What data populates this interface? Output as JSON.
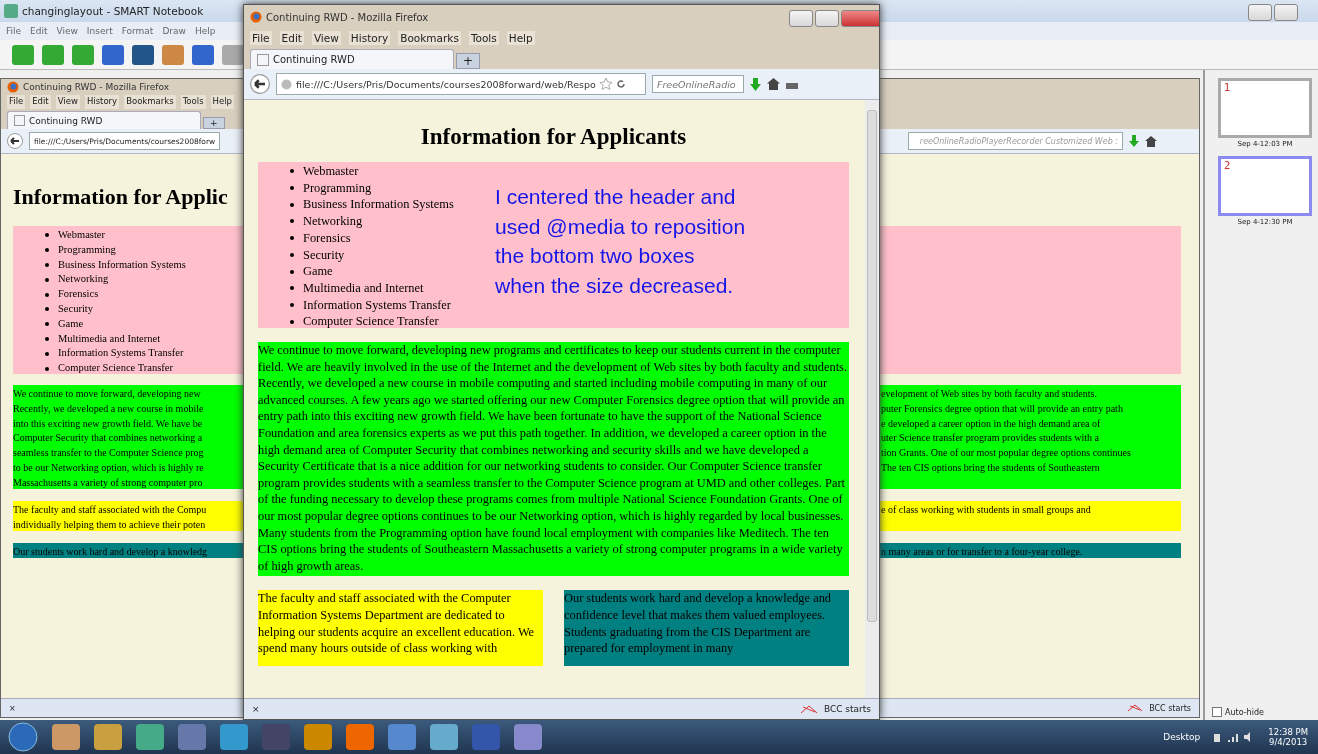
{
  "notebook": {
    "title": "changinglayout - SMART Notebook",
    "menu": [
      "File",
      "Edit",
      "View",
      "Insert",
      "Format",
      "Draw",
      "Help"
    ]
  },
  "background_browser": {
    "title": "Continuing RWD - Mozilla Firefox",
    "menu": [
      "File",
      "Edit",
      "View",
      "History",
      "Bookmarks",
      "Tools",
      "Help"
    ],
    "tab": "Continuing RWD",
    "new_tab": "+",
    "url": "file:///C:/Users/Pris/Documents/courses2008forw",
    "search": "reeOnlineRadioPlayerRecorder Customized Web :",
    "heading": "Information for Applic",
    "list": [
      "Webmaster",
      "Programming",
      "Business Information Systems",
      "Networking",
      "Forensics",
      "Security",
      "Game",
      "Multimedia and Internet",
      "Information Systems Transfer",
      "Computer Science Transfer"
    ],
    "green_left": [
      "We continue to move forward, developing new",
      "Recently, we developed a new course in mobile",
      "into this exciting new growth field. We have be",
      "Computer Security that combines networking a",
      "seamless transfer to the Computer Science prog",
      "to be our Networking option, which is highly re",
      "Massachusetts a variety of strong computer pro"
    ],
    "green_right": [
      "evelopment of Web sites by both faculty and students.",
      "puter Forensics degree option that will provide an entry path",
      "e developed a career option in the high demand area of",
      "uter Science transfer program provides students with a",
      "tion Grants. One of our most popular degree options continues",
      "The ten CIS options bring the students of Southeastern"
    ],
    "yellow_left": [
      "The faculty and staff associated with the Compu",
      "individually helping them to achieve their poten"
    ],
    "yellow_right": [
      "e of class working with students in small groups and"
    ],
    "teal_left": [
      "Our students work hard and develop a knowledg"
    ],
    "teal_right": [
      "n many areas or for transfer to a four-year college."
    ],
    "status_close": "×",
    "status": "BCC starts"
  },
  "browser": {
    "title": "Continuing RWD - Mozilla Firefox",
    "menu": [
      "File",
      "Edit",
      "View",
      "History",
      "Bookmarks",
      "Tools",
      "Help"
    ],
    "tab": "Continuing RWD",
    "new_tab": "+",
    "url": "file:///C:/Users/Pris/Documents/courses2008forward/web/Respo",
    "search_placeholder": "FreeOnlineRadio",
    "heading": "Information for Applicants",
    "list": [
      "Webmaster",
      "Programming",
      "Business Information Systems",
      "Networking",
      "Forensics",
      "Security",
      "Game",
      "Multimedia and Internet",
      "Information Systems Transfer",
      "Computer Science Transfer"
    ],
    "green_text": "We continue to move forward, developing new programs and certificates to keep our students current in the computer field. We are heavily involved in the use of the Internet and the development of Web sites by both faculty and students. Recently, we developed a new course in mobile computing and started including mobile computing in many of our advanced courses. A few years ago we started offering our new Computer Forensics degree option that will provide an entry path into this exciting new growth field. We have been fortunate to have the support of the National Science Foundation and area forensics experts as we put this path together. In addition, we developed a career option in the high demand area of Computer Security that combines networking and security skills and we have developed a Security Certificate that is a nice addition for our networking students to consider. Our Computer Science transfer program provides students with a seamless transfer to the Computer Science program at UMD and other colleges. Part of the funding necessary to develop these programs comes from multiple National Science Foundation Grants. One of our most popular degree options continues to be our Networking option, which is highly regarded by local businesses. Many students from the Programming option have found local employment with companies like Meditech. The ten CIS options bring the students of Southeastern Massachusetts a variety of strong computer programs in a wide variety of high growth areas.",
    "yellow_text": "The faculty and staff associated with the Computer Information Systems Department are dedicated to helping our students acquire an excellent education. We spend many hours outside of class working with",
    "teal_text": "Our students work hard and develop a knowledge and confidence level that makes them valued employees. Students graduating from the CIS Department are prepared for employment in many",
    "status_close": "×",
    "status": "BCC starts"
  },
  "annotation": [
    "I centered the header and",
    "used @media to reposition",
    "the bottom two boxes",
    "when the size decreased."
  ],
  "pages": [
    {
      "number": "1",
      "time": "Sep 4-12:03 PM",
      "selected": false
    },
    {
      "number": "2",
      "time": "Sep 4-12:30 PM",
      "selected": true
    }
  ],
  "auto_hide": {
    "label": "Auto-hide",
    "checked": false
  },
  "taskbar": {
    "desktop": "Desktop",
    "time": "12:38 PM",
    "date": "9/4/2013"
  }
}
